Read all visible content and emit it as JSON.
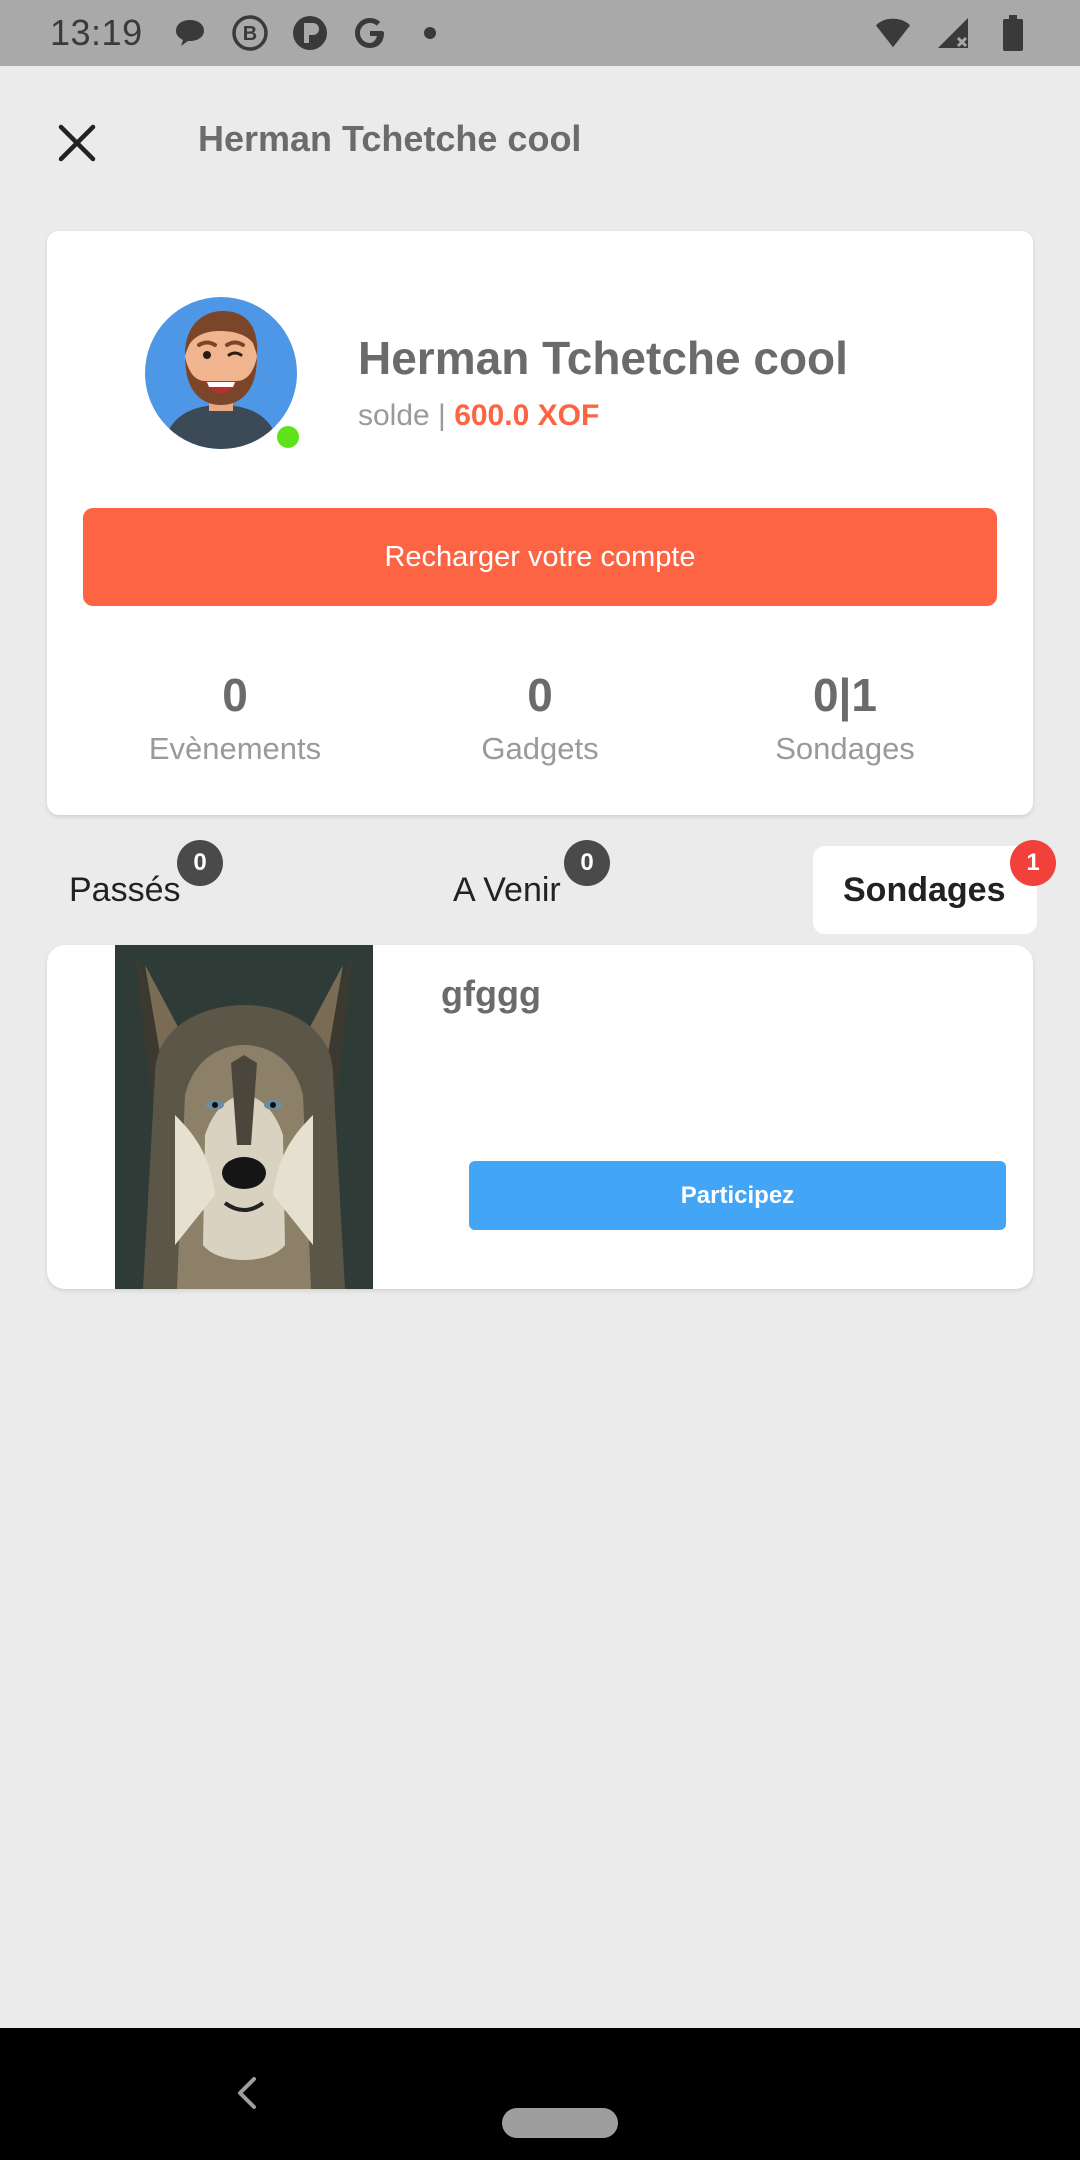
{
  "status_bar": {
    "time": "13:19",
    "left_icons": [
      "chat-bubble-icon",
      "b-circle-icon",
      "p-circle-icon",
      "google-g-icon",
      "dot-icon"
    ],
    "right_icons": [
      "wifi-icon",
      "signal-icon",
      "battery-icon"
    ]
  },
  "app_bar": {
    "title": "Herman Tchetche cool",
    "close_icon": "close-icon"
  },
  "profile": {
    "name": "Herman Tchetche cool",
    "balance_label": "solde | ",
    "balance_amount": "600.0 XOF",
    "online": true,
    "recharge_label": "Recharger votre compte",
    "stats": [
      {
        "value": "0",
        "label": "Evènements"
      },
      {
        "value": "0",
        "label": "Gadgets"
      },
      {
        "value": "0|1",
        "label": "Sondages"
      }
    ]
  },
  "tabs": [
    {
      "label": "Passés",
      "badge": "0",
      "active": false
    },
    {
      "label": "A Venir",
      "badge": "0",
      "active": false
    },
    {
      "label": "Sondages",
      "badge": "1",
      "active": true
    }
  ],
  "poll": {
    "title": "gfggg",
    "button_label": "Participez"
  },
  "colors": {
    "accent_orange": "#fc6443",
    "button_blue": "#42a5f5",
    "online_green": "#5ee21c",
    "badge_red": "#f2403a",
    "badge_dark": "#4a4a4a"
  }
}
